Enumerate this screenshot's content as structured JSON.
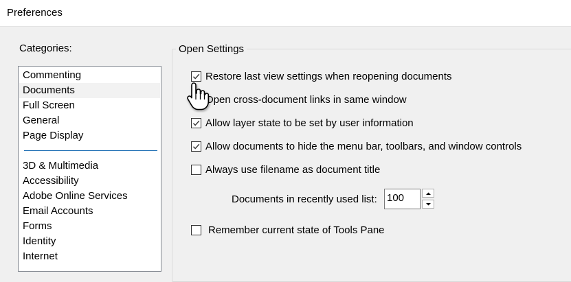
{
  "window": {
    "title": "Preferences"
  },
  "categories": {
    "label": "Categories:",
    "group1": [
      "Commenting",
      "Documents",
      "Full Screen",
      "General",
      "Page Display"
    ],
    "group2": [
      "3D & Multimedia",
      "Accessibility",
      "Adobe Online Services",
      "Email Accounts",
      "Forms",
      "Identity",
      "Internet"
    ],
    "selected": "Documents"
  },
  "open_settings": {
    "legend": "Open Settings",
    "options": [
      {
        "label": "Restore last view settings when reopening documents",
        "checked": true
      },
      {
        "label": "Open cross-document links in same window",
        "checked": false
      },
      {
        "label": "Allow layer state to be set by user information",
        "checked": true
      },
      {
        "label": "Allow documents to hide the menu bar, toolbars, and window controls",
        "checked": true
      },
      {
        "label": "Always use filename as document title",
        "checked": false
      }
    ],
    "recent_list": {
      "label": "Documents in recently used list:",
      "value": "100"
    },
    "tools_pane": {
      "label": "Remember current state of Tools Pane",
      "checked": false
    }
  },
  "icons": {
    "checkmark": "checkmark-icon",
    "spin_up": "chevron-up-icon",
    "spin_down": "chevron-down-icon",
    "cursor": "hand-pointer-icon"
  }
}
